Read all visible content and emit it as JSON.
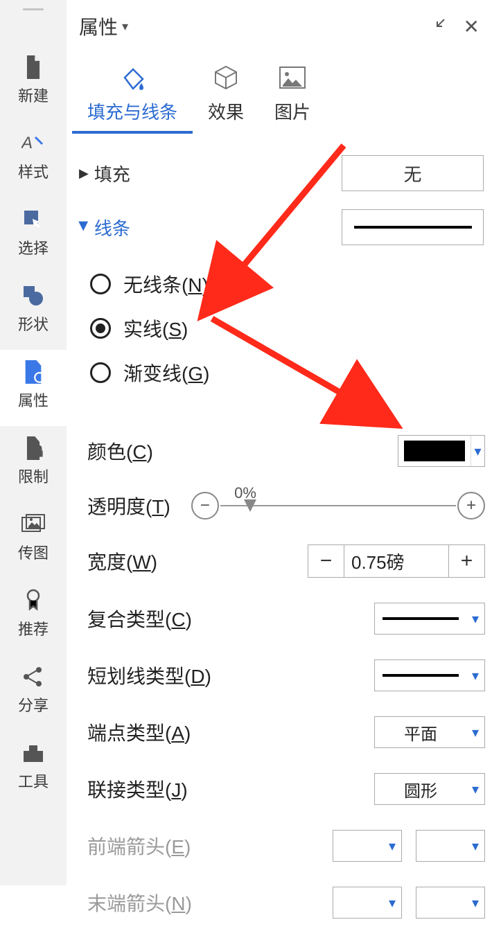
{
  "sidebar": {
    "items": [
      {
        "label": "新建",
        "icon": "newfile"
      },
      {
        "label": "样式",
        "icon": "style"
      },
      {
        "label": "选择",
        "icon": "select"
      },
      {
        "label": "形状",
        "icon": "shape"
      },
      {
        "label": "属性",
        "icon": "prop"
      },
      {
        "label": "限制",
        "icon": "limit"
      },
      {
        "label": "传图",
        "icon": "upload"
      },
      {
        "label": "推荐",
        "icon": "recommend"
      },
      {
        "label": "分享",
        "icon": "share"
      },
      {
        "label": "工具",
        "icon": "tool"
      }
    ],
    "active_index": 4
  },
  "panel": {
    "title": "属性"
  },
  "tabs": {
    "items": [
      {
        "label": "填充与线条"
      },
      {
        "label": "效果"
      },
      {
        "label": "图片"
      }
    ],
    "active_index": 0
  },
  "fill": {
    "section_label": "填充",
    "value": "无"
  },
  "line": {
    "section_label": "线条",
    "options": [
      {
        "label_pre": "无线条(",
        "key": "N",
        "label_post": ")",
        "checked": false
      },
      {
        "label_pre": "实线(",
        "key": "S",
        "label_post": ")",
        "checked": true
      },
      {
        "label_pre": "渐变线(",
        "key": "G",
        "label_post": ")",
        "checked": false
      }
    ],
    "props": {
      "color": {
        "label_pre": "颜色(",
        "key": "C",
        "label_post": ")",
        "value": "#000000"
      },
      "transparency": {
        "label_pre": "透明度(",
        "key": "T",
        "label_post": ")",
        "value": "0%"
      },
      "width": {
        "label_pre": "宽度(",
        "key": "W",
        "label_post": ")",
        "value": "0.75磅"
      },
      "compound": {
        "label_pre": "复合类型(",
        "key": "C",
        "label_post": ")"
      },
      "dash": {
        "label_pre": "短划线类型(",
        "key": "D",
        "label_post": ")"
      },
      "cap": {
        "label_pre": "端点类型(",
        "key": "A",
        "label_post": ")",
        "value": "平面"
      },
      "join": {
        "label_pre": "联接类型(",
        "key": "J",
        "label_post": ")",
        "value": "圆形"
      },
      "arrow_begin": {
        "label_pre": "前端箭头(",
        "key": "E",
        "label_post": ")"
      },
      "arrow_end": {
        "label_pre": "末端箭头(",
        "key": "N",
        "label_post": ")"
      }
    }
  }
}
